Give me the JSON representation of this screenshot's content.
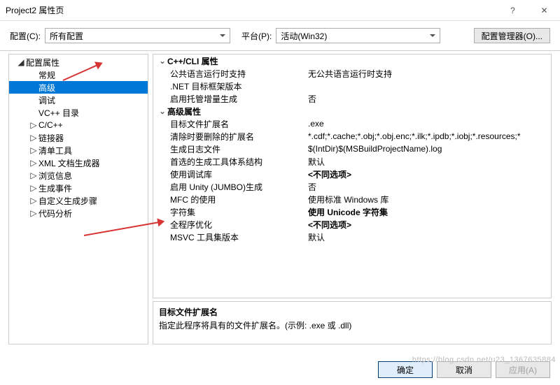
{
  "titlebar": {
    "title": "Project2 属性页",
    "help": "?",
    "close": "✕"
  },
  "configRow": {
    "configLabel": "配置(C):",
    "configValue": "所有配置",
    "platformLabel": "平台(P):",
    "platformValue": "活动(Win32)",
    "managerBtn": "配置管理器(O)..."
  },
  "sidebar": {
    "root": "配置属性",
    "items": [
      {
        "label": "常规",
        "exp": false,
        "sel": false
      },
      {
        "label": "高级",
        "exp": false,
        "sel": true
      },
      {
        "label": "调试",
        "exp": false,
        "sel": false
      },
      {
        "label": "VC++ 目录",
        "exp": false,
        "sel": false
      },
      {
        "label": "C/C++",
        "exp": true,
        "sel": false
      },
      {
        "label": "链接器",
        "exp": true,
        "sel": false
      },
      {
        "label": "清单工具",
        "exp": true,
        "sel": false
      },
      {
        "label": "XML 文档生成器",
        "exp": true,
        "sel": false
      },
      {
        "label": "浏览信息",
        "exp": true,
        "sel": false
      },
      {
        "label": "生成事件",
        "exp": true,
        "sel": false
      },
      {
        "label": "自定义生成步骤",
        "exp": true,
        "sel": false
      },
      {
        "label": "代码分析",
        "exp": true,
        "sel": false
      }
    ]
  },
  "grid": {
    "group1": "C++/CLI 属性",
    "group2": "高级属性",
    "rows1": [
      {
        "k": "公共语言运行时支持",
        "v": "无公共语言运行时支持"
      },
      {
        "k": ".NET 目标框架版本",
        "v": ""
      },
      {
        "k": "启用托管增量生成",
        "v": "否"
      }
    ],
    "rows2": [
      {
        "k": "目标文件扩展名",
        "v": ".exe",
        "sel": true
      },
      {
        "k": "清除时要删除的扩展名",
        "v": "*.cdf;*.cache;*.obj;*.obj.enc;*.ilk;*.ipdb;*.iobj;*.resources;*"
      },
      {
        "k": "生成日志文件",
        "v": "$(IntDir)$(MSBuildProjectName).log"
      },
      {
        "k": "首选的生成工具体系结构",
        "v": "默认"
      },
      {
        "k": "使用调试库",
        "v": "<不同选项>",
        "bold": true
      },
      {
        "k": "启用 Unity (JUMBO)生成",
        "v": "否"
      },
      {
        "k": "MFC 的使用",
        "v": "使用标准 Windows 库"
      },
      {
        "k": "字符集",
        "v": "使用 Unicode 字符集",
        "bold": true
      },
      {
        "k": "全程序优化",
        "v": "<不同选项>",
        "bold": true
      },
      {
        "k": "MSVC 工具集版本",
        "v": "默认"
      }
    ]
  },
  "desc": {
    "title": "目标文件扩展名",
    "text": "指定此程序将具有的文件扩展名。(示例: .exe 或 .dll)"
  },
  "buttons": {
    "ok": "确定",
    "cancel": "取消",
    "apply": "应用(A)"
  },
  "watermark": "https://blog.csdn.net/u23_1367635884"
}
